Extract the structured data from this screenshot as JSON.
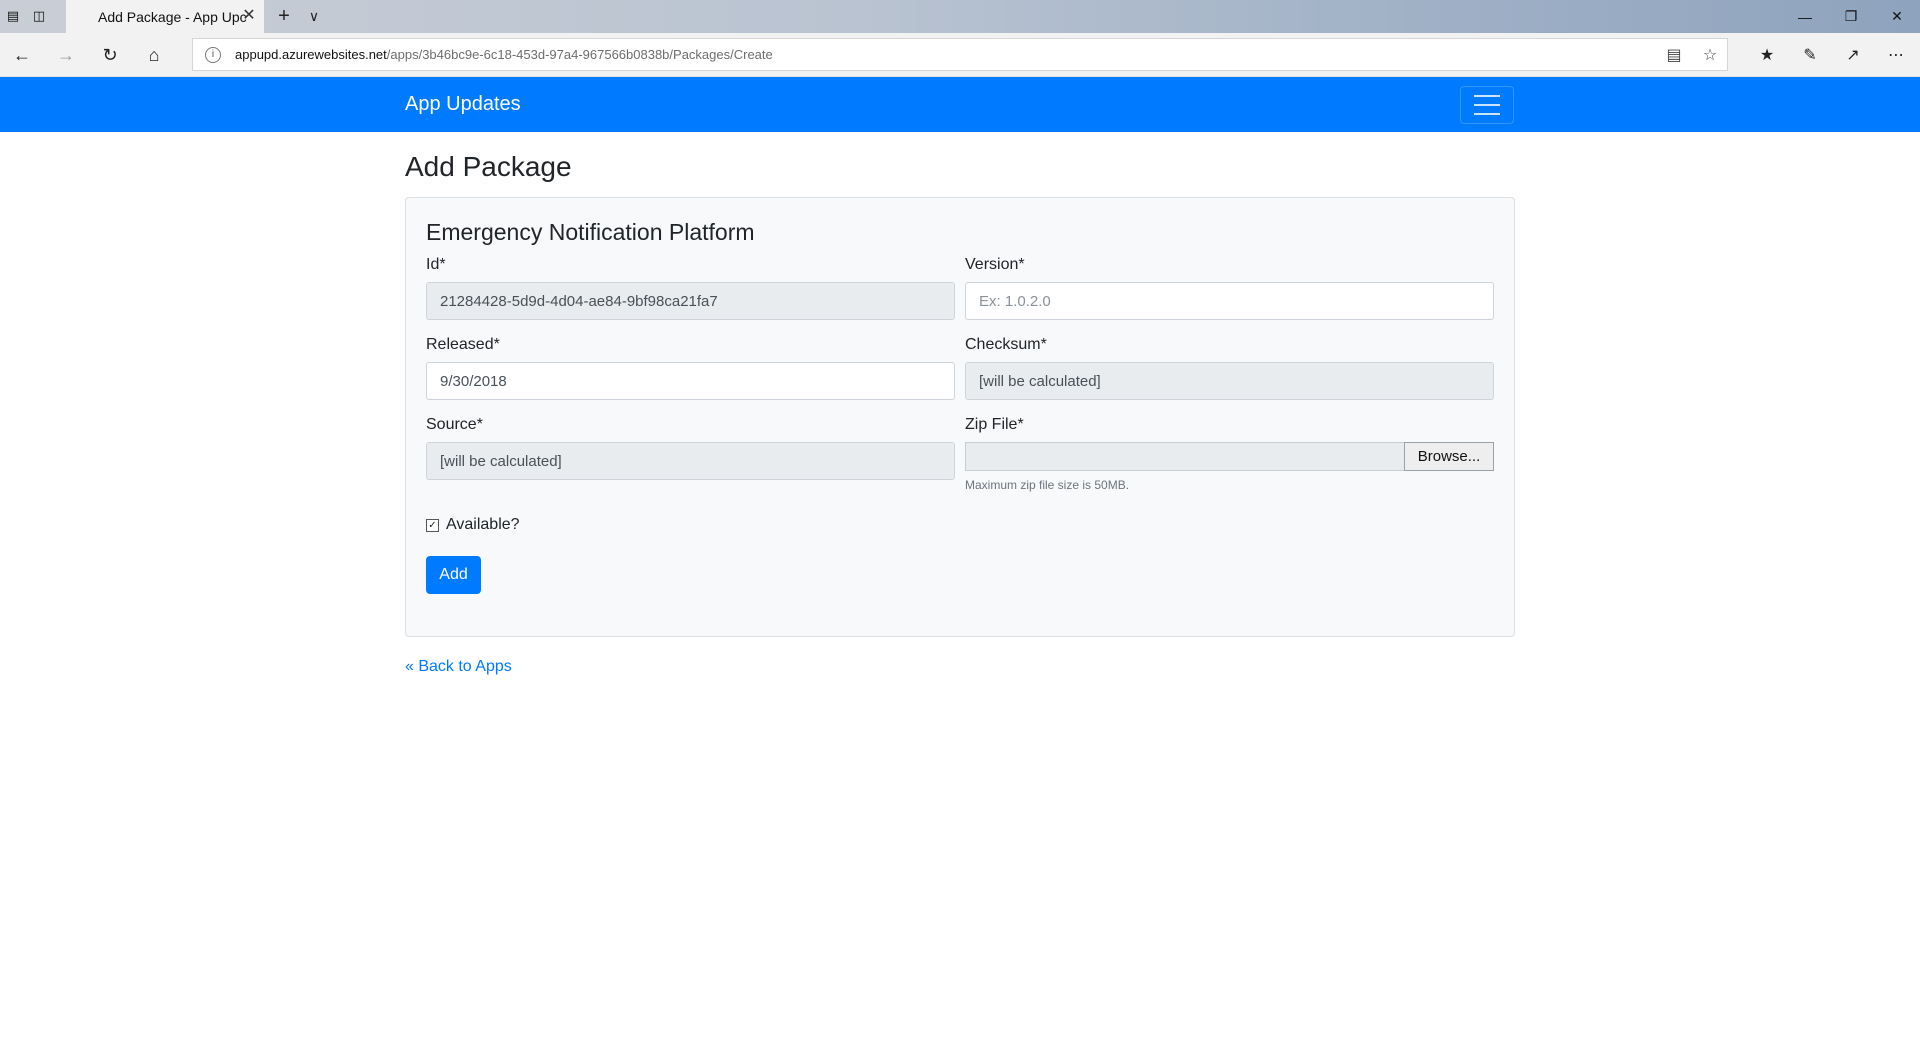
{
  "browser": {
    "tab_title": "Add Package - App Upc",
    "url_domain": "appupd.azurewebsites.net",
    "url_path": "/apps/3b46bc9e-6c18-453d-97a4-967566b0838b/Packages/Create"
  },
  "navbar": {
    "brand": "App Updates"
  },
  "page": {
    "title": "Add Package",
    "card_title": "Emergency Notification Platform"
  },
  "form": {
    "id_label": "Id*",
    "id_value": "21284428-5d9d-4d04-ae84-9bf98ca21fa7",
    "version_label": "Version*",
    "version_placeholder": "Ex: 1.0.2.0",
    "released_label": "Released*",
    "released_value": "9/30/2018",
    "checksum_label": "Checksum*",
    "checksum_value": "[will be calculated]",
    "source_label": "Source*",
    "source_value": "[will be calculated]",
    "zip_label": "Zip File*",
    "zip_browse": "Browse...",
    "zip_help": "Maximum zip file size is 50MB.",
    "available_label": "Available?",
    "available_checked": true,
    "submit_label": "Add"
  },
  "links": {
    "back": "« Back to Apps"
  }
}
